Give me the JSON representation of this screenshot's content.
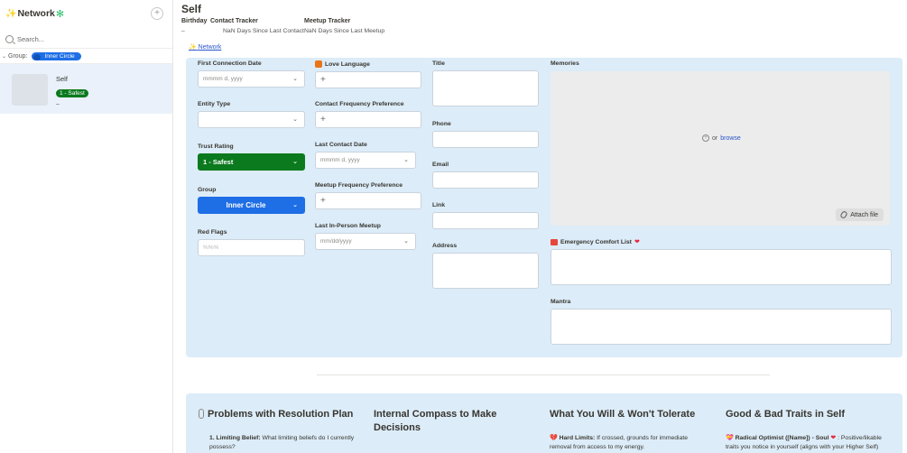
{
  "sidebar": {
    "title": "Network",
    "add_label": "+",
    "search_placeholder": "Search...",
    "group_label": "Group:",
    "group_value": "Inner Circle",
    "card": {
      "name": "Self",
      "tag": "1 - Safest",
      "dash": "–"
    }
  },
  "header": {
    "title": "Self",
    "props": [
      {
        "label": "Birthday",
        "value": "–"
      },
      {
        "label": "Contact Tracker",
        "value": "NaN Days Since Last Contact"
      },
      {
        "label": "Meetup Tracker",
        "value": "NaN Days Since Last Meetup"
      }
    ],
    "link": "Network"
  },
  "form": {
    "first_connection": {
      "label": "First Connection Date",
      "placeholder": "mmmm d, yyyy"
    },
    "entity_type": {
      "label": "Entity Type",
      "value": ""
    },
    "trust_rating": {
      "label": "Trust Rating",
      "value": "1 - Safest"
    },
    "group": {
      "label": "Group",
      "value": "Inner Circle"
    },
    "red_flags": {
      "label": "Red Flags",
      "placeholder": "%%%"
    },
    "love_language": {
      "label": "Love Language"
    },
    "contact_freq": {
      "label": "Contact Frequency Preference"
    },
    "last_contact": {
      "label": "Last Contact Date",
      "placeholder": "mmmm d, yyyy"
    },
    "meetup_freq": {
      "label": "Meetup Frequency Preference"
    },
    "last_meetup": {
      "label": "Last In-Person Meetup",
      "placeholder": "mm/dd/yyyy"
    },
    "title": {
      "label": "Title"
    },
    "phone": {
      "label": "Phone"
    },
    "email": {
      "label": "Email"
    },
    "link": {
      "label": "Link"
    },
    "address": {
      "label": "Address"
    },
    "memories": {
      "label": "Memories",
      "or_text": "or",
      "browse": "browse",
      "attach": "Attach file"
    },
    "emergency": {
      "label": "Emergency Comfort List"
    },
    "mantra": {
      "label": "Mantra"
    },
    "plus": "+",
    "chevron": "⌄"
  },
  "bottom": [
    {
      "heading": "Problems with Resolution Plan",
      "text_bold": "1. Limiting Belief:",
      "text": " What limiting beliefs do I currently possess?"
    },
    {
      "heading": "Internal Compass to Make Decisions",
      "text_bold": "",
      "text": ""
    },
    {
      "heading": "What You Will & Won't Tolerate",
      "text_bold": "Hard Limits:",
      "text": " If crossed, grounds for immediate removal from access to my energy."
    },
    {
      "heading": "Good & Bad Traits in Self",
      "text_bold": "Radical Optimist ([Name]) - Soul",
      "text": " : Positive/likable traits you notice in yourself (aligns with your Higher Self)"
    }
  ]
}
